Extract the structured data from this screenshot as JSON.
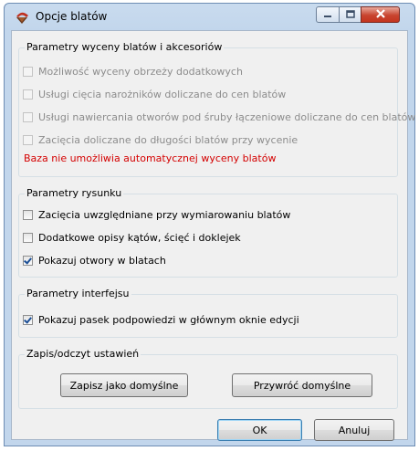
{
  "window": {
    "title": "Opcje blatów"
  },
  "pricing": {
    "legend": "Parametry wyceny blatów i akcesoriów",
    "options": [
      {
        "label": "Możliwość wyceny obrzeży dodatkowych",
        "checked": false,
        "enabled": false
      },
      {
        "label": "Usługi cięcia narożników doliczane do cen blatów",
        "checked": false,
        "enabled": false
      },
      {
        "label": "Usługi nawiercania otworów pod śruby łączeniowe doliczane do cen blatów",
        "checked": false,
        "enabled": false
      },
      {
        "label": "Zacięcia doliczane do długości blatów przy wycenie",
        "checked": false,
        "enabled": false
      }
    ],
    "warning": "Baza nie umożliwia automatycznej wyceny blatów"
  },
  "drawing": {
    "legend": "Parametry rysunku",
    "options": [
      {
        "label": "Zacięcia uwzględniane przy wymiarowaniu blatów",
        "checked": false,
        "enabled": true
      },
      {
        "label": "Dodatkowe opisy kątów, ścięć i doklejek",
        "checked": false,
        "enabled": true
      },
      {
        "label": "Pokazuj otwory w blatach",
        "checked": true,
        "enabled": true
      }
    ]
  },
  "interface": {
    "legend": "Parametry interfejsu",
    "options": [
      {
        "label": "Pokazuj pasek podpowiedzi w głównym oknie edycji",
        "checked": true,
        "enabled": true
      }
    ]
  },
  "settings_io": {
    "legend": "Zapis/odczyt ustawień",
    "save_default": "Zapisz jako domyślne",
    "restore_default": "Przywróć domyślne"
  },
  "footer": {
    "ok": "OK",
    "cancel": "Anuluj"
  },
  "icons": {
    "app": "app-icon",
    "minimize": "minimize-icon",
    "maximize": "maximize-icon",
    "close": "close-icon"
  },
  "colors": {
    "warning": "#d40000",
    "title_bar": "#c2d6ec",
    "close_button": "#c8442f"
  }
}
